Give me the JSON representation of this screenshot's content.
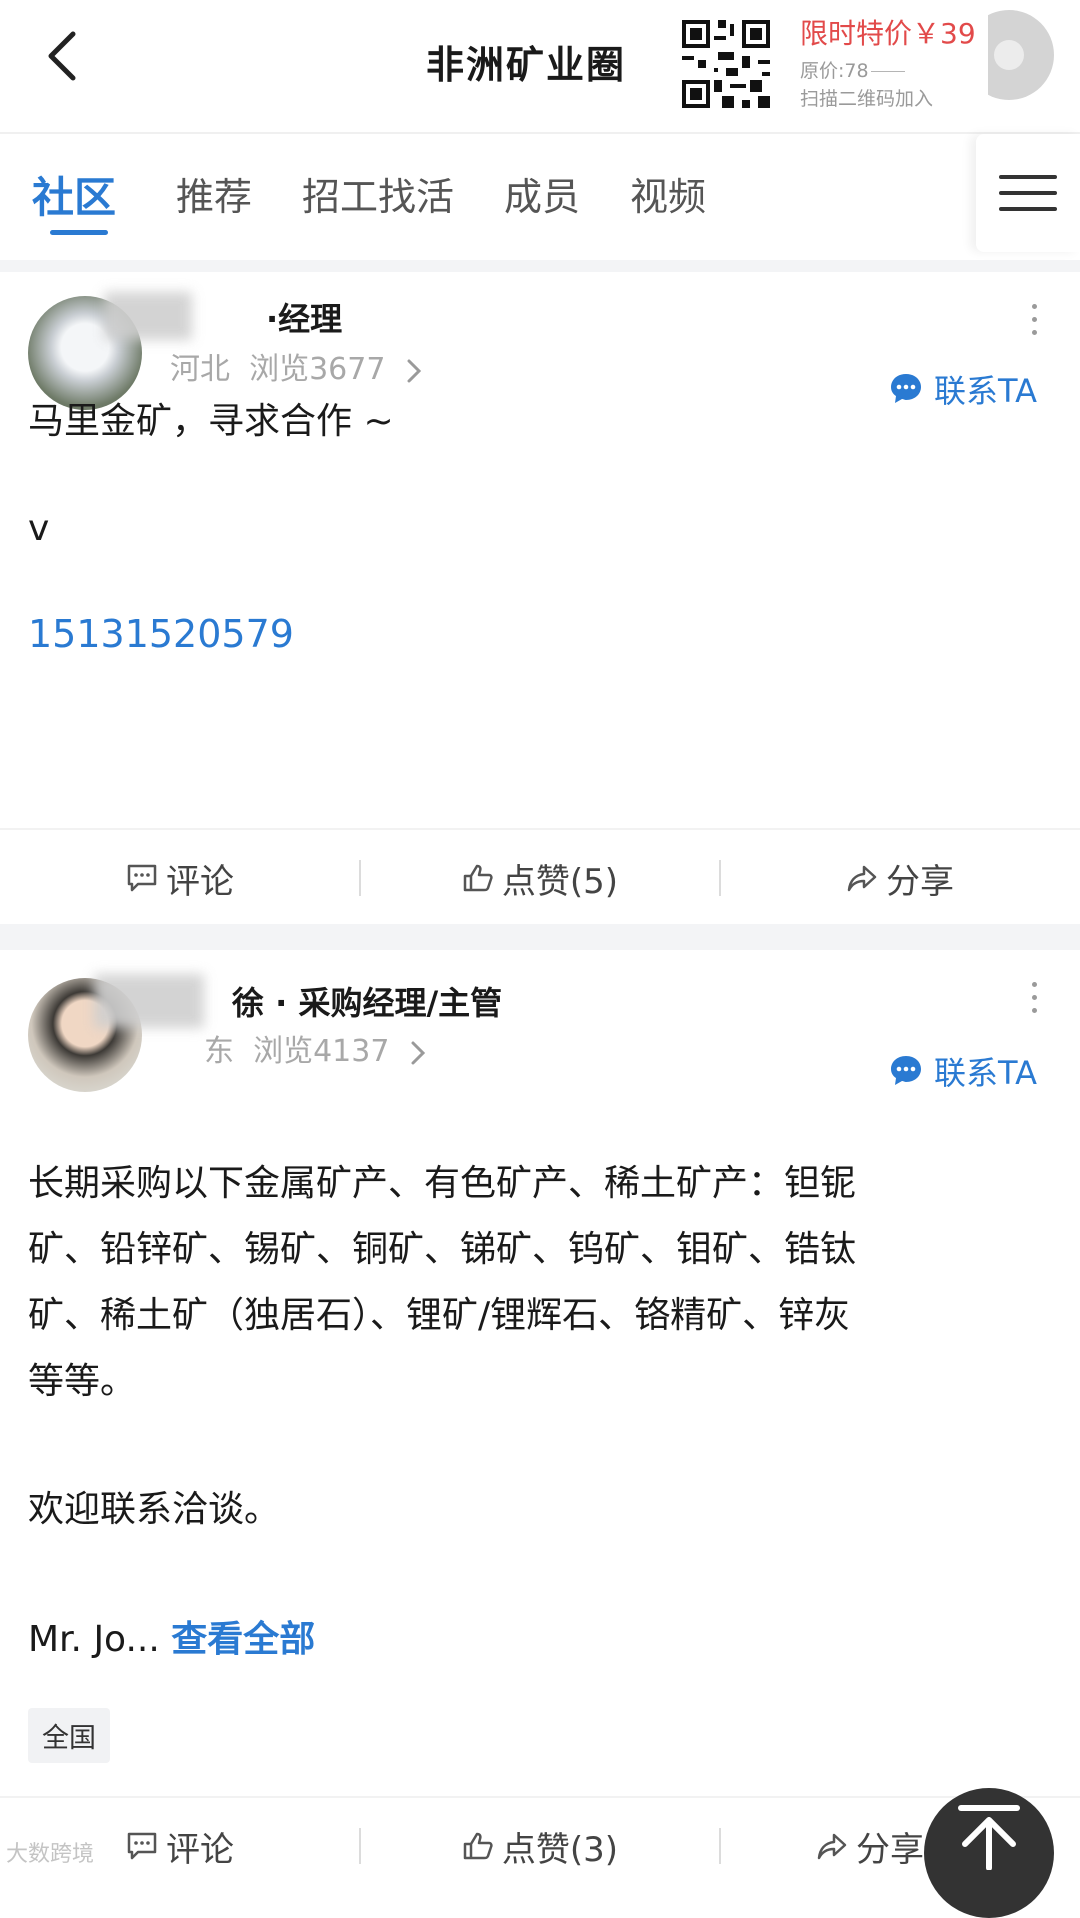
{
  "header": {
    "title": "非洲矿业圈",
    "promo": {
      "price_text": "限时特价￥39",
      "original_price": "原价:78",
      "scan_text": "扫描二维码加入"
    }
  },
  "tabs": [
    {
      "label": "社区",
      "active": true
    },
    {
      "label": "推荐"
    },
    {
      "label": "招工找活"
    },
    {
      "label": "成员"
    },
    {
      "label": "视频"
    }
  ],
  "posts": [
    {
      "author": "·经理",
      "location": "河北",
      "views": "浏览3677",
      "contact_label": "联系TA",
      "lines": [
        "马里金矿，寻求合作 ~",
        "v"
      ],
      "phone": "15131520579",
      "actions": {
        "comment": "评论",
        "like": "点赞(5)",
        "share": "分享"
      }
    },
    {
      "author": "徐 · 采购经理/主管",
      "location": "东",
      "views": "浏览4137",
      "contact_label": "联系TA",
      "lines": [
        "长期采购以下金属矿产、有色矿产、稀土矿产：钽铌",
        "矿、铅锌矿、锡矿、铜矿、锑矿、钨矿、钼矿、锆钛",
        "矿、稀土矿（独居石）、锂矿/锂辉石、铬精矿、锌灰",
        "等等。",
        "欢迎联系洽谈。"
      ],
      "truncated_text": "Mr. Jo...",
      "view_all": "查看全部",
      "tag": "全国",
      "actions": {
        "comment": "评论",
        "like": "点赞(3)",
        "share": "分享"
      }
    }
  ],
  "watermark": "大数跨境"
}
